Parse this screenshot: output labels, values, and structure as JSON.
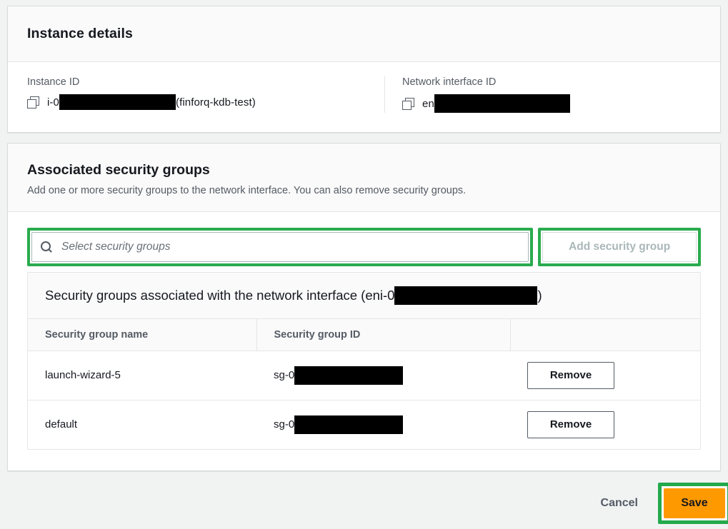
{
  "instance_details": {
    "title": "Instance details",
    "fields": [
      {
        "label": "Instance ID",
        "icon": "copy-icon",
        "prefix": "i-0",
        "redacted_width": 163,
        "suffix": "(finforq-kdb-test)"
      },
      {
        "label": "Network interface ID",
        "icon": "copy-icon",
        "prefix": "en",
        "redacted_width": 190,
        "suffix": ""
      }
    ]
  },
  "security_groups": {
    "title": "Associated security groups",
    "description": "Add one or more security groups to the network interface. You can also remove security groups.",
    "search": {
      "icon": "search-icon",
      "placeholder": "Select security groups",
      "value": ""
    },
    "add_button": {
      "label": "Add security group",
      "disabled": true
    },
    "table": {
      "title_prefix": "Security groups associated with the network interface (eni-0",
      "title_redacted_width": 200,
      "title_suffix": ")",
      "columns": [
        "Security group name",
        "Security group ID",
        ""
      ],
      "rows": [
        {
          "name": "launch-wizard-5",
          "id_prefix": "sg-0",
          "id_redacted_width": 152,
          "action_label": "Remove"
        },
        {
          "name": "default",
          "id_prefix": "sg-0",
          "id_redacted_width": 152,
          "action_label": "Remove"
        }
      ]
    }
  },
  "footer": {
    "cancel_label": "Cancel",
    "save_label": "Save"
  },
  "colors": {
    "highlight_green": "#2aab4f",
    "save_orange": "#ff9900",
    "page_background": "#f1f3f3",
    "card_background": "#ffffff",
    "muted_text": "#545b64"
  }
}
